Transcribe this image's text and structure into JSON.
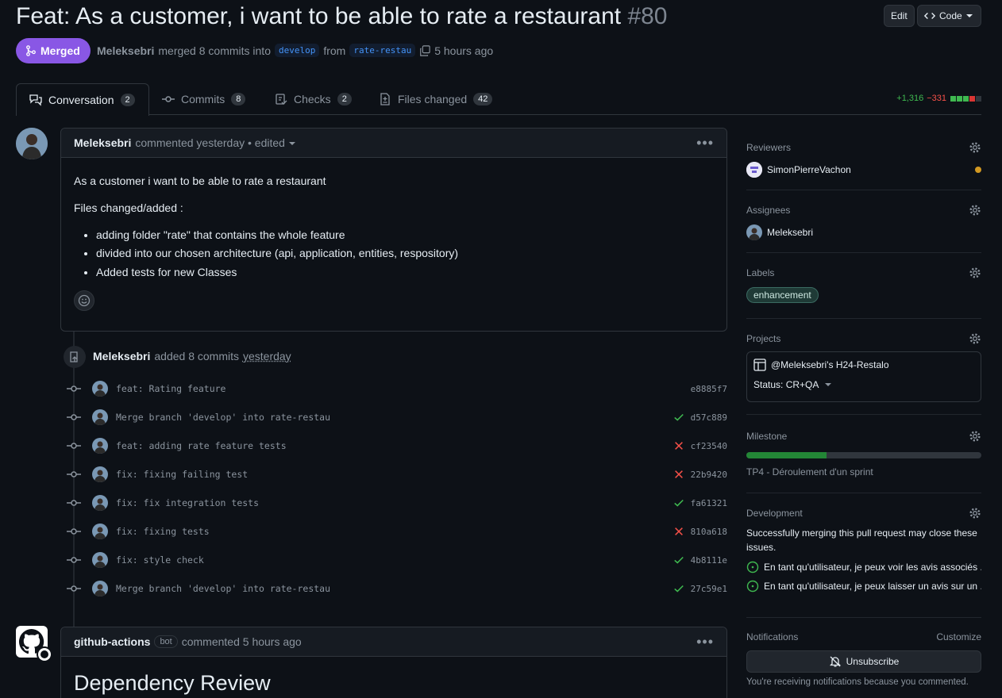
{
  "header": {
    "title": "Feat: As a customer, i want to be able to rate a restaurant",
    "number": "#80",
    "edit_label": "Edit",
    "code_label": "Code"
  },
  "status": {
    "label": "Merged",
    "author": "Meleksebri",
    "text": "merged 8 commits into",
    "base": "develop",
    "from": "from",
    "head": "rate-restau",
    "time": "5 hours ago"
  },
  "tabs": [
    {
      "label": "Conversation",
      "count": "2"
    },
    {
      "label": "Commits",
      "count": "8"
    },
    {
      "label": "Checks",
      "count": "2"
    },
    {
      "label": "Files changed",
      "count": "42"
    }
  ],
  "diffstat": {
    "additions": "+1,316",
    "deletions": "−331"
  },
  "comment1": {
    "author": "Meleksebri",
    "action": "commented yesterday • edited",
    "body_p1": "As a customer i want to be able to rate a restaurant",
    "body_p2": "Files changed/added :",
    "bullets": [
      "adding folder \"rate\" that contains the whole feature",
      "divided into our chosen architecture (api, application, entities, respository)",
      "Added tests for new Classes"
    ]
  },
  "commits_event": {
    "author": "Meleksebri",
    "text": "added 8 commits",
    "time": "yesterday"
  },
  "commits": [
    {
      "message": "feat: Rating feature",
      "sha": "e8885f7",
      "status": "none"
    },
    {
      "message": "Merge branch 'develop' into rate-restau",
      "sha": "d57c889",
      "status": "success"
    },
    {
      "message": "feat: adding rate feature tests",
      "sha": "cf23540",
      "status": "failure"
    },
    {
      "message": "fix: fixing failing test",
      "sha": "22b9420",
      "status": "failure"
    },
    {
      "message": "fix: fix integration tests",
      "sha": "fa61321",
      "status": "success"
    },
    {
      "message": "fix: fixing tests",
      "sha": "810a618",
      "status": "failure"
    },
    {
      "message": "fix: style check",
      "sha": "4b8111e",
      "status": "success"
    },
    {
      "message": "Merge branch 'develop' into rate-restau",
      "sha": "27c59e1",
      "status": "success"
    }
  ],
  "comment2": {
    "author": "github-actions",
    "badge": "bot",
    "action": "commented 5 hours ago",
    "heading": "Dependency Review"
  },
  "sidebar": {
    "reviewers": {
      "title": "Reviewers",
      "name": "SimonPierreVachon"
    },
    "assignees": {
      "title": "Assignees",
      "name": "Meleksebri"
    },
    "labels": {
      "title": "Labels",
      "label": "enhancement"
    },
    "projects": {
      "title": "Projects",
      "name": "@Meleksebri's H24-Restalo",
      "status": "Status: CR+QA"
    },
    "milestone": {
      "title": "Milestone",
      "name": "TP4 - Déroulement d'un sprint",
      "progress": 0.34
    },
    "development": {
      "title": "Development",
      "text": "Successfully merging this pull request may close these issues.",
      "issues": [
        "En tant qu'utilisateur, je peux voir les avis associés ...",
        "En tant qu'utilisateur, je peux laisser un avis sur un ..."
      ]
    },
    "notifications": {
      "title": "Notifications",
      "customize": "Customize",
      "button": "Unsubscribe",
      "note": "You're receiving notifications because you commented."
    }
  },
  "colors": {
    "accent_merged": "#8957e5",
    "success": "#3fb950",
    "failure": "#f85149",
    "pending": "#d29922"
  }
}
